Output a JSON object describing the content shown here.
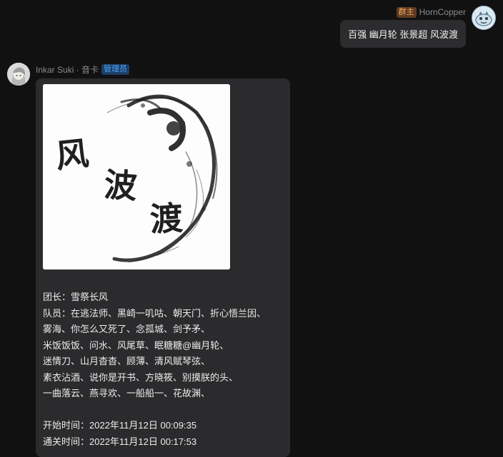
{
  "right_message": {
    "role_badge": "群主",
    "sender": "HornCopper",
    "text": "百强 幽月轮 张景超 风波渡"
  },
  "left_message": {
    "sender": "Inkar Suki · 音卡",
    "role_badge": "管理员",
    "image_text": "风波渡",
    "lines": [
      "团长：雪祭长风",
      "队员：在逃法师、黑崎一叽咕、朝天门、折心悟兰因、",
      "雾海、你怎么又死了、念孤城、剑予矛、",
      "米饭饭饭、问水、风尾草、眠糖糖@幽月轮、",
      "迷情刀、山月杳杳、顾薄、清风赋琴弦、",
      "素衣沾酒、说你是开书、方晓筱、别摸朕的头、",
      "一曲落云、燕寻欢、一船船一、花故渊、"
    ],
    "start_time": "开始时间：2022年11月12日 00:09:35",
    "clear_time": "通关时间：2022年11月12日 00:17:53"
  }
}
